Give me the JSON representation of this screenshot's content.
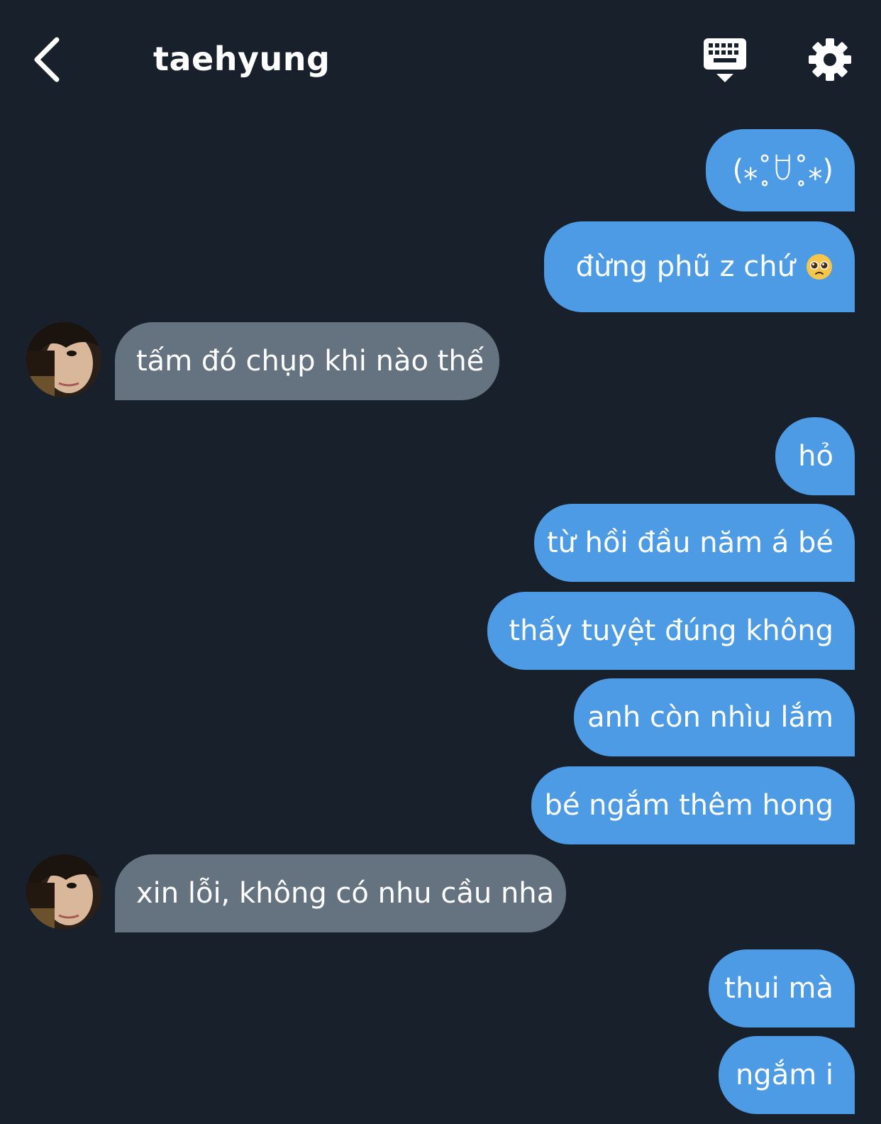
{
  "header": {
    "title": "taehyung",
    "icons": {
      "back": "chevron-left-icon",
      "keyboard": "keyboard-icon",
      "settings": "gear-icon"
    }
  },
  "colors": {
    "background": "#18202b",
    "sent_bubble": "#4d9be5",
    "received_bubble": "#657381",
    "text": "#ffffff"
  },
  "messages": [
    {
      "from": "me",
      "text": "(⁎˚̥ꇴ˚̥⁎)"
    },
    {
      "from": "me",
      "text": "đừng phũ z chứ",
      "emoji": "pleading-face-emoji"
    },
    {
      "from": "taehyung",
      "text": "tấm đó chụp khi nào thế"
    },
    {
      "from": "me",
      "text": "hỏ"
    },
    {
      "from": "me",
      "text": "từ hồi đầu năm á bé"
    },
    {
      "from": "me",
      "text": "thấy tuyệt đúng không"
    },
    {
      "from": "me",
      "text": "anh còn nhìu lắm"
    },
    {
      "from": "me",
      "text": "bé ngắm thêm hong"
    },
    {
      "from": "taehyung",
      "text": "xin lỗi, không có nhu cầu nha"
    },
    {
      "from": "me",
      "text": "thui mà"
    },
    {
      "from": "me",
      "text": "ngắm i"
    }
  ]
}
